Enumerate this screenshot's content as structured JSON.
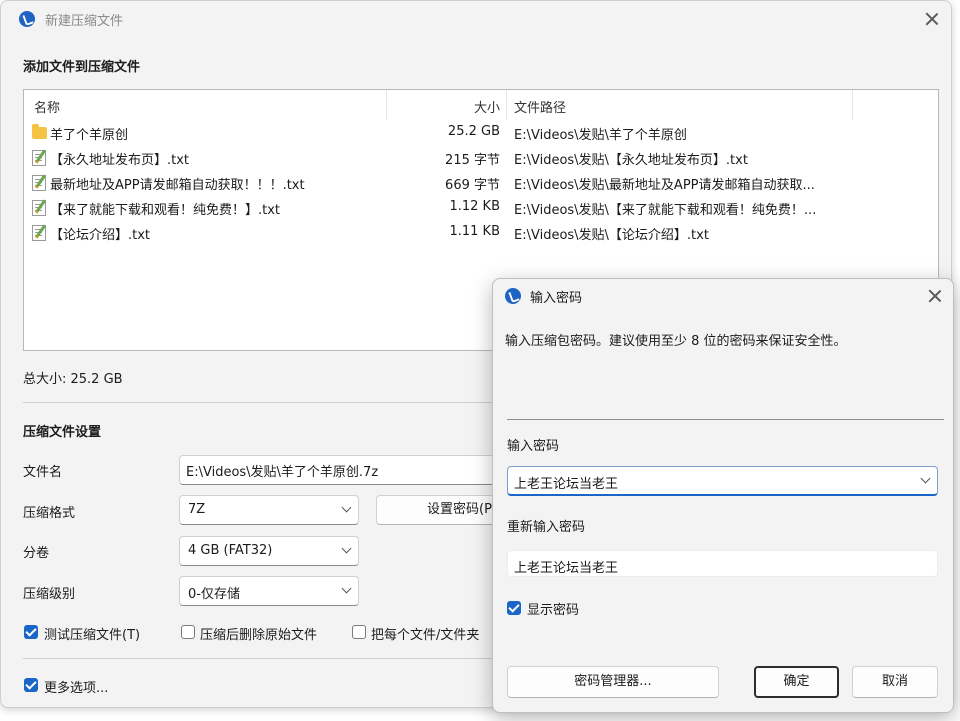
{
  "main_window": {
    "title": "新建压缩文件",
    "files_heading": "添加文件到压缩文件",
    "list": {
      "col_name": "名称",
      "col_size": "大小",
      "col_path": "文件路径",
      "rows": [
        {
          "icon": "folder-icon",
          "name": "羊了个羊原创",
          "size": "25.2 GB",
          "path": "E:\\Videos\\发贴\\羊了个羊原创"
        },
        {
          "icon": "txt-file-icon",
          "name": "【永久地址发布页】.txt",
          "size": "215 字节",
          "path": "E:\\Videos\\发贴\\【永久地址发布页】.txt"
        },
        {
          "icon": "txt-file-icon",
          "name": "最新地址及APP请发邮箱自动获取！！！.txt",
          "size": "669 字节",
          "path": "E:\\Videos\\发贴\\最新地址及APP请发邮箱自动获取..."
        },
        {
          "icon": "txt-file-icon",
          "name": "【来了就能下载和观看！纯免费！】.txt",
          "size": "1.12 KB",
          "path": "E:\\Videos\\发贴\\【来了就能下载和观看！纯免费！..."
        },
        {
          "icon": "txt-file-icon",
          "name": "【论坛介绍】.txt",
          "size": "1.11 KB",
          "path": "E:\\Videos\\发贴\\【论坛介绍】.txt"
        }
      ]
    },
    "total_size": "总大小: 25.2 GB",
    "settings_heading": "压缩文件设置",
    "filename_label": "文件名",
    "filename_value": "E:\\Videos\\发贴\\羊了个羊原创.7z",
    "format_label": "压缩格式",
    "format_value": "7Z",
    "set_password_button": "设置密码(P)",
    "split_label": "分卷",
    "split_value": "4 GB (FAT32)",
    "level_label": "压缩级别",
    "level_value": "0-仅存储",
    "test_archive": "测试压缩文件(T)",
    "delete_after": "压缩后删除原始文件",
    "each_file": "把每个文件/文件夹",
    "more_options": "更多选项..."
  },
  "password_dialog": {
    "title": "输入密码",
    "description": "输入压缩包密码。建议使用至少 8 位的密码来保证安全性。",
    "password_label": "输入密码",
    "password_value": "上老王论坛当老王",
    "confirm_label": "重新输入密码",
    "confirm_value": "上老王论坛当老王",
    "show_password": "显示密码",
    "manager_button": "密码管理器...",
    "ok_button": "确定",
    "cancel_button": "取消"
  },
  "colors": {
    "accent": "#1a66c8",
    "window_bg": "#f3f3f3"
  }
}
